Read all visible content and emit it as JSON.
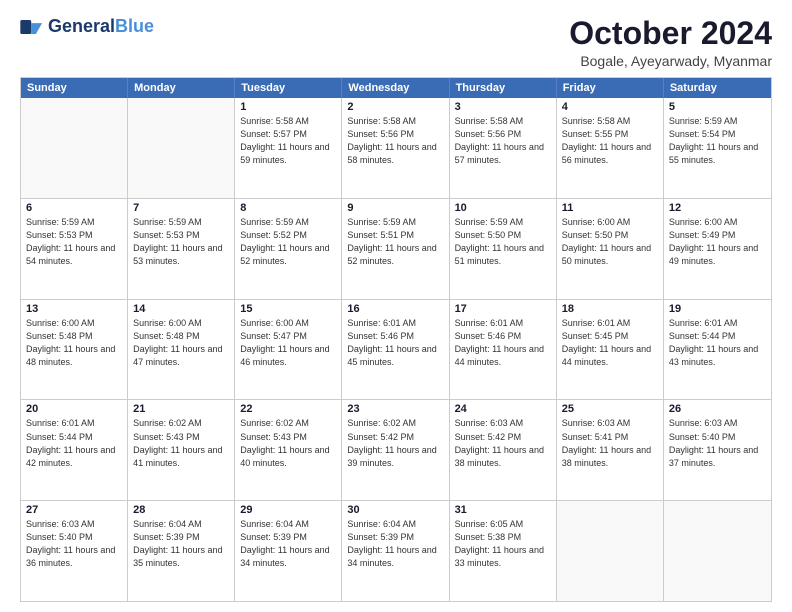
{
  "header": {
    "logo_general": "General",
    "logo_blue": "Blue",
    "month_title": "October 2024",
    "location": "Bogale, Ayeyarwady, Myanmar"
  },
  "weekdays": [
    "Sunday",
    "Monday",
    "Tuesday",
    "Wednesday",
    "Thursday",
    "Friday",
    "Saturday"
  ],
  "rows": [
    [
      {
        "day": "",
        "info": ""
      },
      {
        "day": "",
        "info": ""
      },
      {
        "day": "1",
        "info": "Sunrise: 5:58 AM\nSunset: 5:57 PM\nDaylight: 11 hours and 59 minutes."
      },
      {
        "day": "2",
        "info": "Sunrise: 5:58 AM\nSunset: 5:56 PM\nDaylight: 11 hours and 58 minutes."
      },
      {
        "day": "3",
        "info": "Sunrise: 5:58 AM\nSunset: 5:56 PM\nDaylight: 11 hours and 57 minutes."
      },
      {
        "day": "4",
        "info": "Sunrise: 5:58 AM\nSunset: 5:55 PM\nDaylight: 11 hours and 56 minutes."
      },
      {
        "day": "5",
        "info": "Sunrise: 5:59 AM\nSunset: 5:54 PM\nDaylight: 11 hours and 55 minutes."
      }
    ],
    [
      {
        "day": "6",
        "info": "Sunrise: 5:59 AM\nSunset: 5:53 PM\nDaylight: 11 hours and 54 minutes."
      },
      {
        "day": "7",
        "info": "Sunrise: 5:59 AM\nSunset: 5:53 PM\nDaylight: 11 hours and 53 minutes."
      },
      {
        "day": "8",
        "info": "Sunrise: 5:59 AM\nSunset: 5:52 PM\nDaylight: 11 hours and 52 minutes."
      },
      {
        "day": "9",
        "info": "Sunrise: 5:59 AM\nSunset: 5:51 PM\nDaylight: 11 hours and 52 minutes."
      },
      {
        "day": "10",
        "info": "Sunrise: 5:59 AM\nSunset: 5:50 PM\nDaylight: 11 hours and 51 minutes."
      },
      {
        "day": "11",
        "info": "Sunrise: 6:00 AM\nSunset: 5:50 PM\nDaylight: 11 hours and 50 minutes."
      },
      {
        "day": "12",
        "info": "Sunrise: 6:00 AM\nSunset: 5:49 PM\nDaylight: 11 hours and 49 minutes."
      }
    ],
    [
      {
        "day": "13",
        "info": "Sunrise: 6:00 AM\nSunset: 5:48 PM\nDaylight: 11 hours and 48 minutes."
      },
      {
        "day": "14",
        "info": "Sunrise: 6:00 AM\nSunset: 5:48 PM\nDaylight: 11 hours and 47 minutes."
      },
      {
        "day": "15",
        "info": "Sunrise: 6:00 AM\nSunset: 5:47 PM\nDaylight: 11 hours and 46 minutes."
      },
      {
        "day": "16",
        "info": "Sunrise: 6:01 AM\nSunset: 5:46 PM\nDaylight: 11 hours and 45 minutes."
      },
      {
        "day": "17",
        "info": "Sunrise: 6:01 AM\nSunset: 5:46 PM\nDaylight: 11 hours and 44 minutes."
      },
      {
        "day": "18",
        "info": "Sunrise: 6:01 AM\nSunset: 5:45 PM\nDaylight: 11 hours and 44 minutes."
      },
      {
        "day": "19",
        "info": "Sunrise: 6:01 AM\nSunset: 5:44 PM\nDaylight: 11 hours and 43 minutes."
      }
    ],
    [
      {
        "day": "20",
        "info": "Sunrise: 6:01 AM\nSunset: 5:44 PM\nDaylight: 11 hours and 42 minutes."
      },
      {
        "day": "21",
        "info": "Sunrise: 6:02 AM\nSunset: 5:43 PM\nDaylight: 11 hours and 41 minutes."
      },
      {
        "day": "22",
        "info": "Sunrise: 6:02 AM\nSunset: 5:43 PM\nDaylight: 11 hours and 40 minutes."
      },
      {
        "day": "23",
        "info": "Sunrise: 6:02 AM\nSunset: 5:42 PM\nDaylight: 11 hours and 39 minutes."
      },
      {
        "day": "24",
        "info": "Sunrise: 6:03 AM\nSunset: 5:42 PM\nDaylight: 11 hours and 38 minutes."
      },
      {
        "day": "25",
        "info": "Sunrise: 6:03 AM\nSunset: 5:41 PM\nDaylight: 11 hours and 38 minutes."
      },
      {
        "day": "26",
        "info": "Sunrise: 6:03 AM\nSunset: 5:40 PM\nDaylight: 11 hours and 37 minutes."
      }
    ],
    [
      {
        "day": "27",
        "info": "Sunrise: 6:03 AM\nSunset: 5:40 PM\nDaylight: 11 hours and 36 minutes."
      },
      {
        "day": "28",
        "info": "Sunrise: 6:04 AM\nSunset: 5:39 PM\nDaylight: 11 hours and 35 minutes."
      },
      {
        "day": "29",
        "info": "Sunrise: 6:04 AM\nSunset: 5:39 PM\nDaylight: 11 hours and 34 minutes."
      },
      {
        "day": "30",
        "info": "Sunrise: 6:04 AM\nSunset: 5:39 PM\nDaylight: 11 hours and 34 minutes."
      },
      {
        "day": "31",
        "info": "Sunrise: 6:05 AM\nSunset: 5:38 PM\nDaylight: 11 hours and 33 minutes."
      },
      {
        "day": "",
        "info": ""
      },
      {
        "day": "",
        "info": ""
      }
    ]
  ]
}
